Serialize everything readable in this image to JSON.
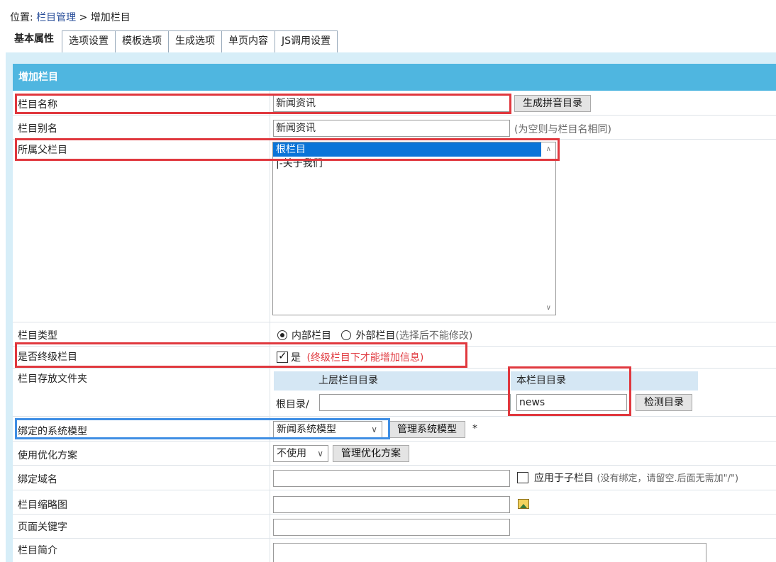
{
  "breadcrumb": {
    "prefix": "位置:",
    "link": "栏目管理",
    "sep": ">",
    "current": "增加栏目"
  },
  "tabs": [
    "基本属性",
    "选项设置",
    "模板选项",
    "生成选项",
    "单页内容",
    "JS调用设置"
  ],
  "panel": {
    "title": "增加栏目"
  },
  "fields": {
    "name": {
      "label": "栏目名称",
      "value": "新闻资讯",
      "button": "生成拼音目录"
    },
    "alias": {
      "label": "栏目别名",
      "value": "新闻资讯",
      "hint": "(为空则与栏目名相同)"
    },
    "parent": {
      "label": "所属父栏目",
      "options": [
        "根栏目",
        "|-关于我们"
      ]
    },
    "type": {
      "label": "栏目类型",
      "option1": "内部栏目",
      "option2": "外部栏目",
      "hint": "(选择后不能修改)"
    },
    "final": {
      "label": "是否终级栏目",
      "check_label": "是",
      "hint": "(终级栏目下才能增加信息)"
    },
    "folder": {
      "label": "栏目存放文件夹",
      "head1": "上层栏目目录",
      "head2": "本栏目目录",
      "root": "根目录/",
      "value": "news",
      "button": "检测目录"
    },
    "model": {
      "label": "绑定的系统模型",
      "value": "新闻系统模型",
      "button": "管理系统模型",
      "star": "*"
    },
    "optimize": {
      "label": "使用优化方案",
      "value": "不使用",
      "button": "管理优化方案"
    },
    "domain": {
      "label": "绑定域名",
      "check_label": "应用于子栏目",
      "hint": "(没有绑定，请留空.后面无需加\"/\")"
    },
    "thumb": {
      "label": "栏目缩略图"
    },
    "keywords": {
      "label": "页面关键字"
    },
    "intro": {
      "label": "栏目简介"
    }
  },
  "colors": {
    "header": "#4fb6e0",
    "highlight_red": "#e0383e",
    "highlight_blue": "#3f8ee4",
    "selected": "#0a74d8"
  }
}
